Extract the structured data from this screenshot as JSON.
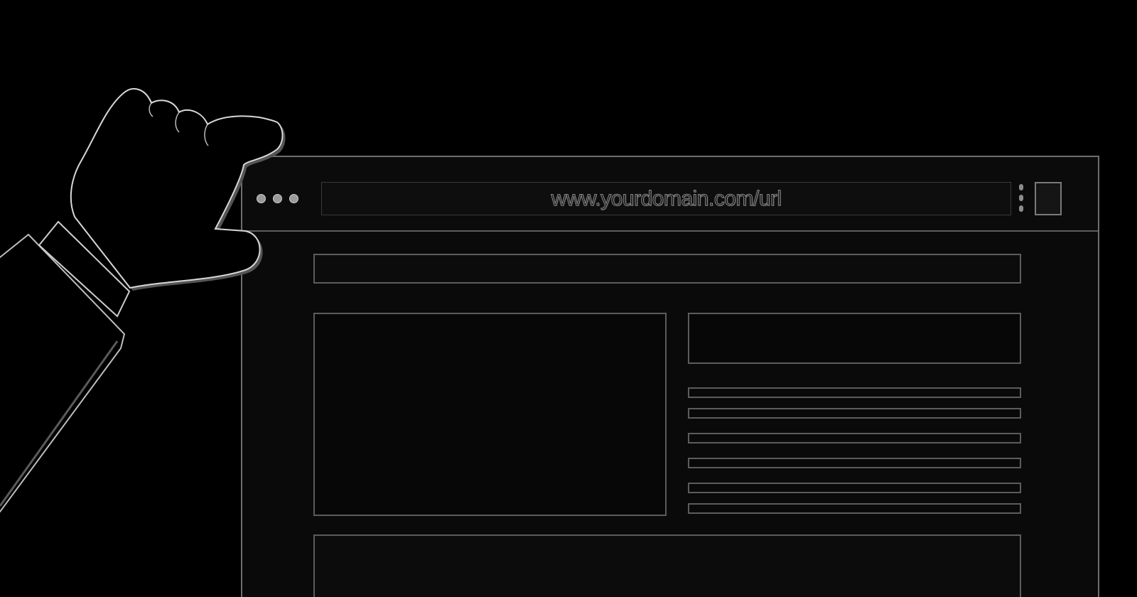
{
  "browser": {
    "address_bar": {
      "url": "www.yourdomain.com/url"
    },
    "window_controls": [
      "dot-1",
      "dot-2",
      "dot-3"
    ],
    "menu_icon": "kebab-menu-icon",
    "extension_icon": "square-button-icon"
  },
  "illustration": {
    "hand_icon": "pointing-hand-icon"
  },
  "colors": {
    "background": "#000000",
    "window": "#0a0a0a",
    "outline": "#6e6e6e"
  }
}
